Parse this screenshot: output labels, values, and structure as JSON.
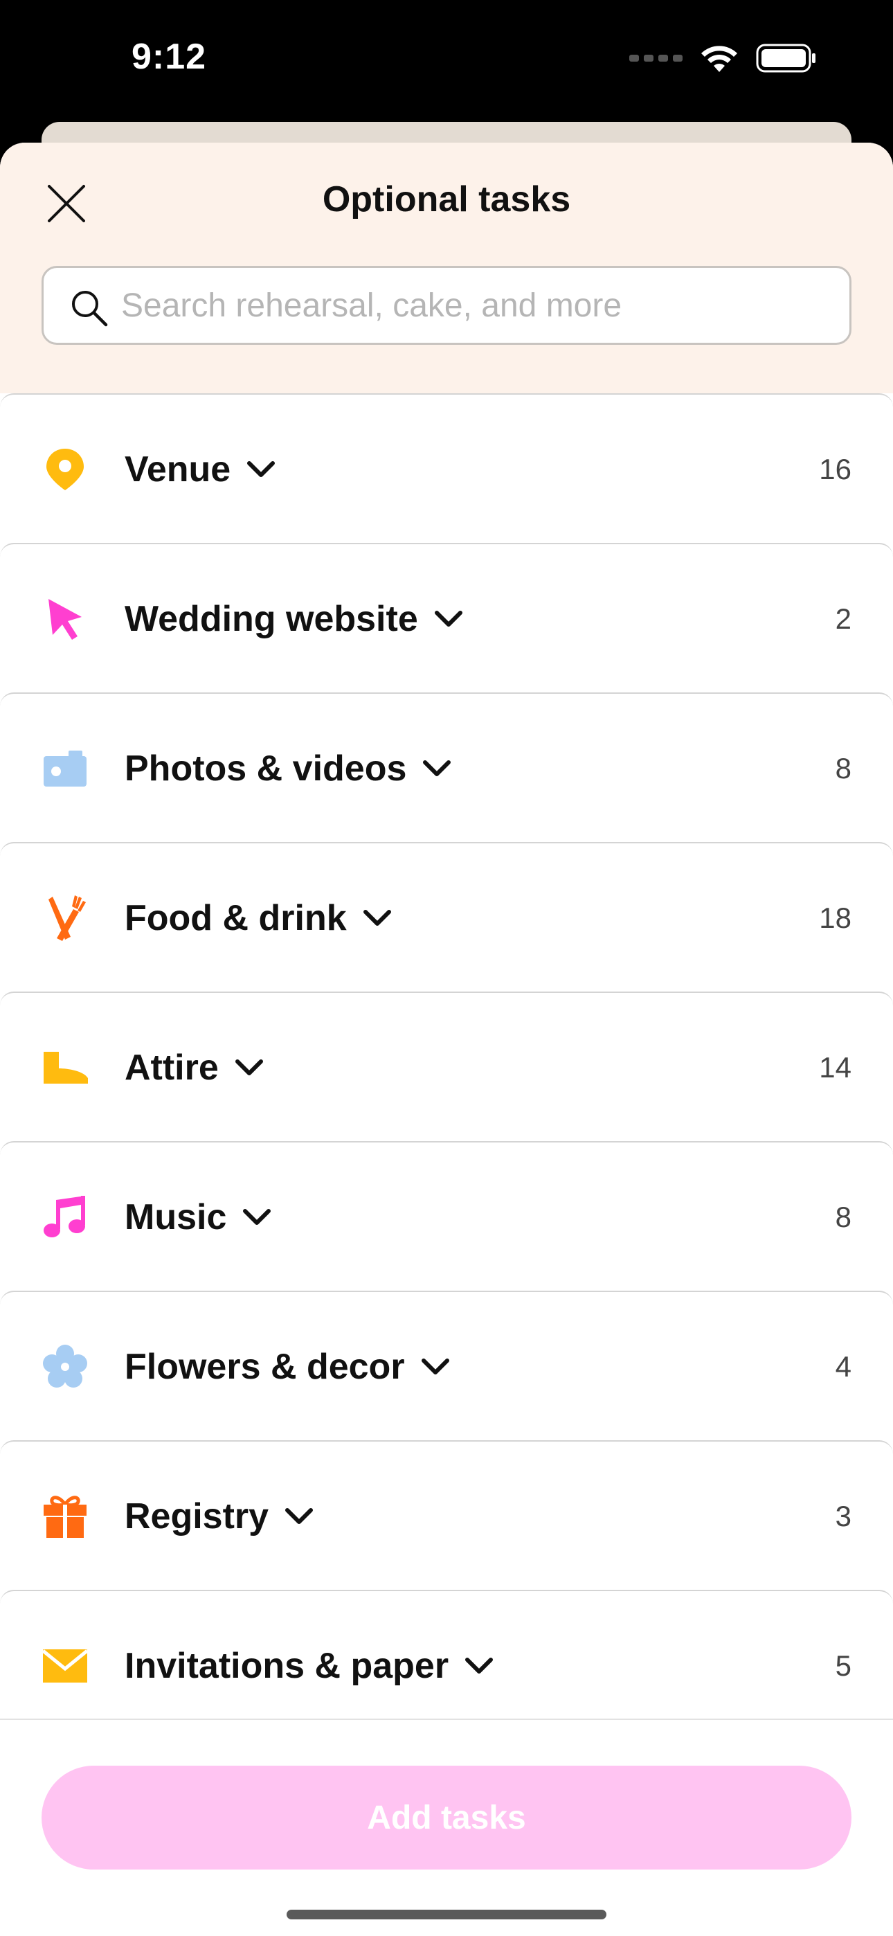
{
  "status_bar": {
    "time": "9:12"
  },
  "header": {
    "title": "Optional tasks",
    "close_icon": "close-icon"
  },
  "search": {
    "placeholder": "Search rehearsal, cake, and more",
    "value": "",
    "icon": "search-icon"
  },
  "categories": [
    {
      "label": "Venue",
      "count": "16",
      "icon": "location-pin-icon",
      "color": "#ffbb0f"
    },
    {
      "label": "Wedding website",
      "count": "2",
      "icon": "cursor-arrow-icon",
      "color": "#ff3fd0"
    },
    {
      "label": "Photos & videos",
      "count": "8",
      "icon": "camera-icon",
      "color": "#a7cdf3"
    },
    {
      "label": "Food & drink",
      "count": "18",
      "icon": "fork-knife-icon",
      "color": "#ff6a12"
    },
    {
      "label": "Attire",
      "count": "14",
      "icon": "boot-icon",
      "color": "#ffbb0f"
    },
    {
      "label": "Music",
      "count": "8",
      "icon": "music-note-icon",
      "color": "#ff3fd0"
    },
    {
      "label": "Flowers & decor",
      "count": "4",
      "icon": "flower-icon",
      "color": "#a7cdf3"
    },
    {
      "label": "Registry",
      "count": "3",
      "icon": "gift-icon",
      "color": "#ff6a12"
    },
    {
      "label": "Invitations & paper",
      "count": "5",
      "icon": "envelope-icon",
      "color": "#ffbb0f"
    }
  ],
  "footer": {
    "add_label": "Add tasks",
    "button_color": "#ffc4f2"
  }
}
